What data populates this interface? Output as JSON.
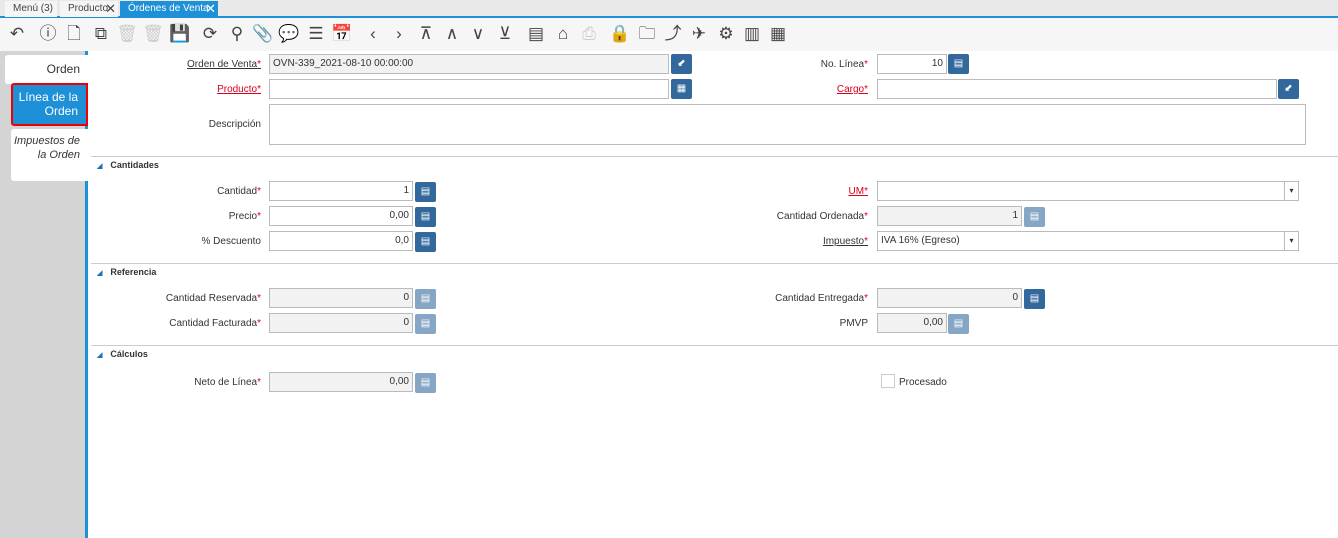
{
  "tabs": [
    {
      "label": "Menú (3)"
    },
    {
      "label": "Producto"
    },
    {
      "label": "Órdenes de Venta"
    }
  ],
  "side_tabs": [
    "Orden",
    "Línea de la Orden",
    "Impuestos de la Orden"
  ],
  "fields": {
    "orden_venta": {
      "label": "Orden de Venta",
      "value": "OVN-339_2021-08-10 00:00:00"
    },
    "no_linea": {
      "label": "No. Línea",
      "value": "10"
    },
    "producto": {
      "label": "Producto",
      "value": ""
    },
    "cargo": {
      "label": "Cargo",
      "value": ""
    },
    "descripcion": {
      "label": "Descripción",
      "value": ""
    },
    "cantidad": {
      "label": "Cantidad",
      "value": "1"
    },
    "um": {
      "label": "UM",
      "value": ""
    },
    "precio": {
      "label": "Precio",
      "value": "0,00"
    },
    "cantidad_ordenada": {
      "label": "Cantidad Ordenada",
      "value": "1"
    },
    "descuento": {
      "label": "% Descuento",
      "value": "0,0"
    },
    "impuesto": {
      "label": "Impuesto",
      "value": "IVA 16% (Egreso)"
    },
    "cant_reservada": {
      "label": "Cantidad Reservada",
      "value": "0"
    },
    "cant_entregada": {
      "label": "Cantidad Entregada",
      "value": "0"
    },
    "cant_facturada": {
      "label": "Cantidad Facturada",
      "value": "0"
    },
    "pmvp": {
      "label": "PMVP",
      "value": "0,00"
    },
    "neto": {
      "label": "Neto de Línea",
      "value": "0,00"
    },
    "procesado": {
      "label": "Procesado",
      "checked": false
    }
  },
  "sections": {
    "cantidades": "Cantidades",
    "referencia": "Referencia",
    "calculos": "Cálculos"
  },
  "required_mark": "*",
  "colors": {
    "accent": "#1e90d8",
    "button": "#33689c",
    "required": "#d8001b"
  }
}
